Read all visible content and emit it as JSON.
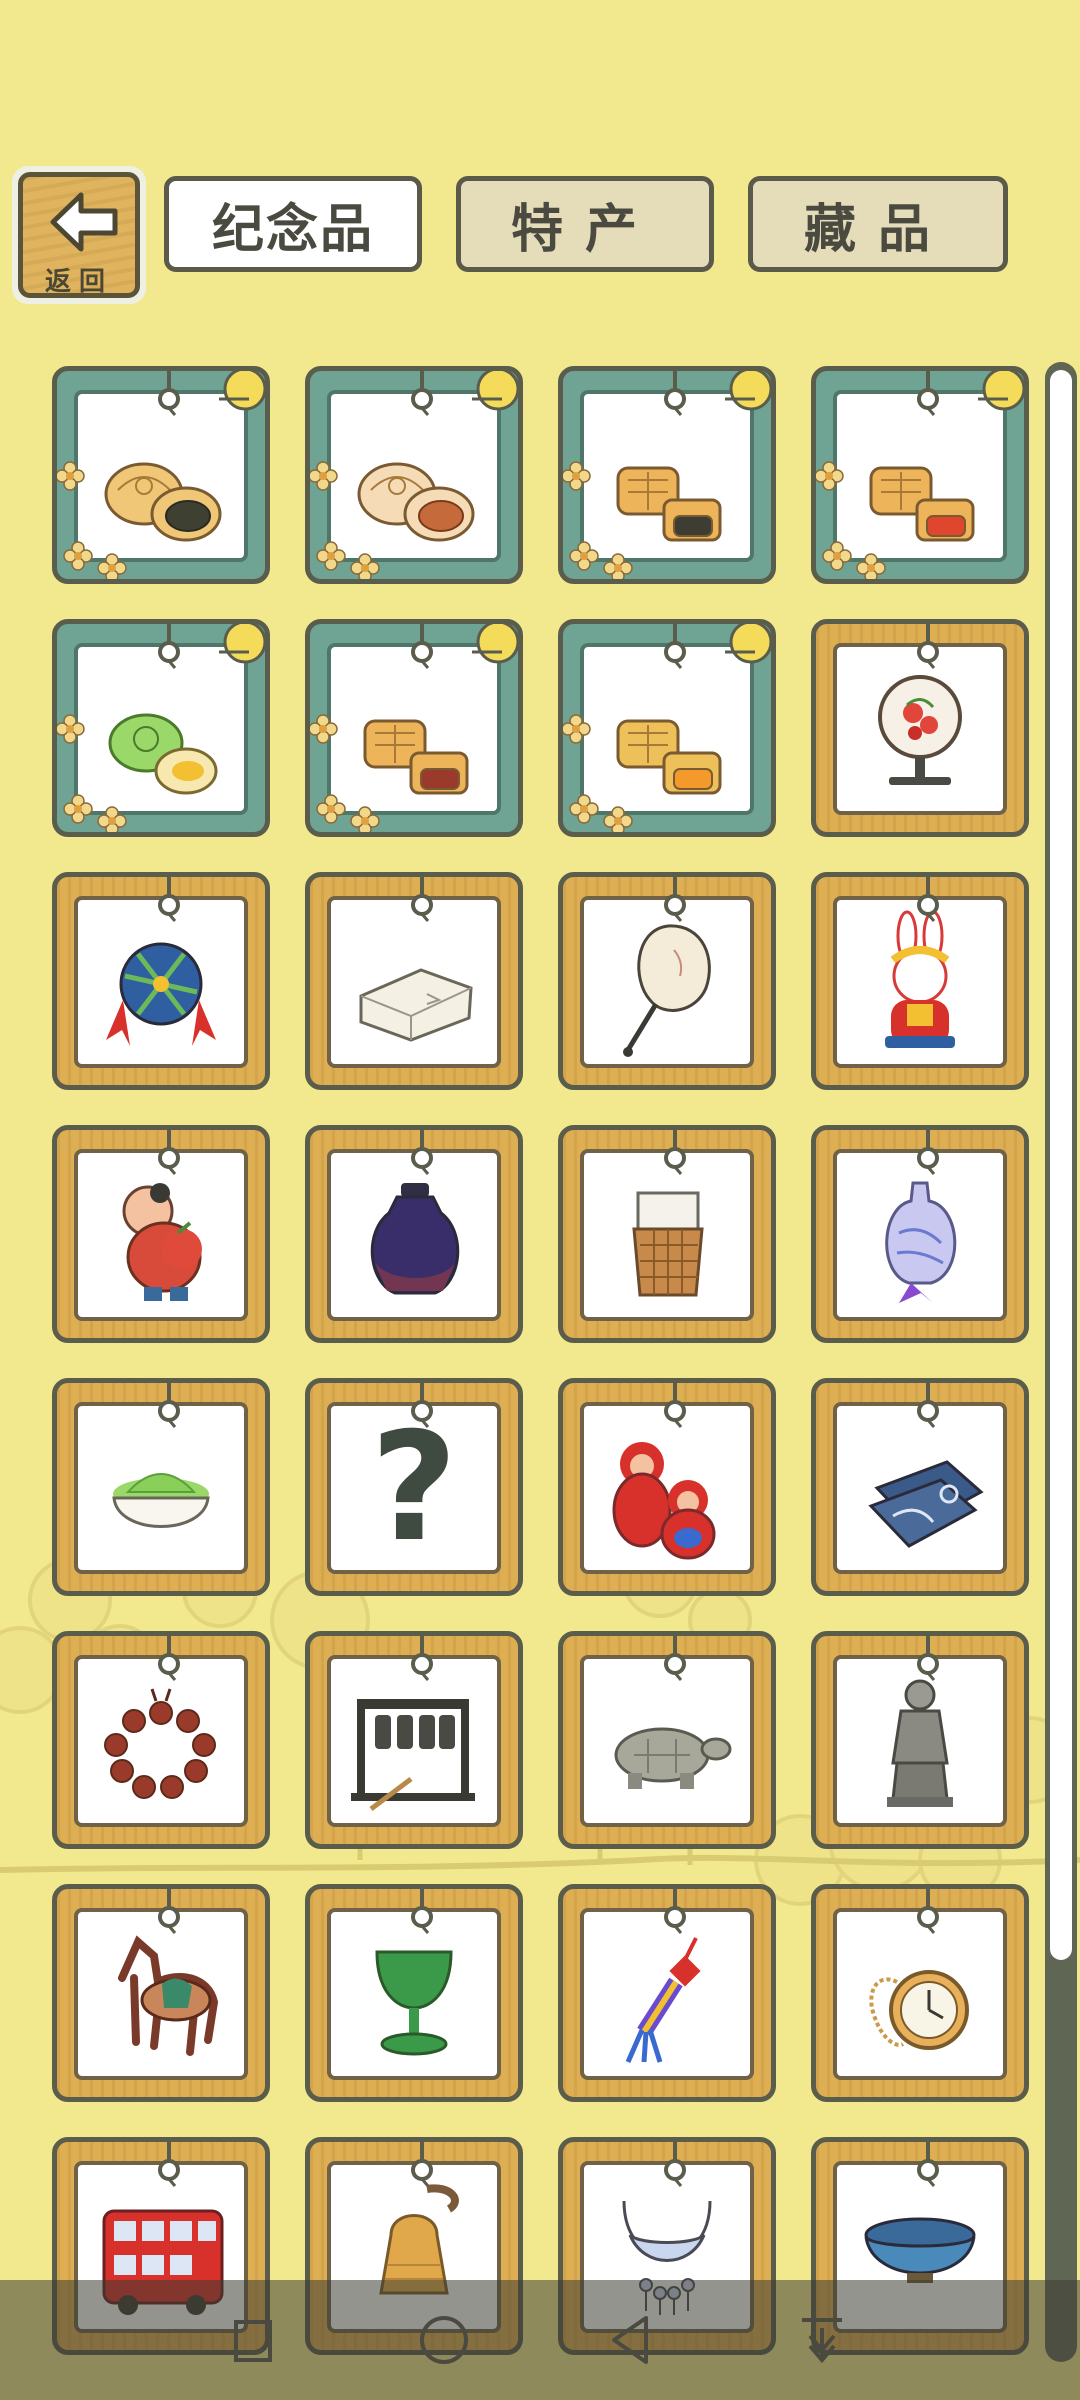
{
  "header": {
    "back_label": "返回",
    "tabs": [
      {
        "label": "纪念品",
        "active": true
      },
      {
        "label": "特产",
        "active": false
      },
      {
        "label": "藏品",
        "active": false
      }
    ]
  },
  "collection": {
    "items": [
      {
        "name": "lotus-seed-mooncake",
        "frame": "teal"
      },
      {
        "name": "red-bean-mooncake",
        "frame": "teal"
      },
      {
        "name": "five-nut-mooncake",
        "frame": "teal"
      },
      {
        "name": "yolk-mooncake",
        "frame": "teal"
      },
      {
        "name": "green-tea-mooncake",
        "frame": "teal"
      },
      {
        "name": "date-paste-mooncake",
        "frame": "teal"
      },
      {
        "name": "orange-mooncake",
        "frame": "teal"
      },
      {
        "name": "embroidery-screen",
        "frame": "gold"
      },
      {
        "name": "embroidered-ball",
        "frame": "gold"
      },
      {
        "name": "silk-pillow",
        "frame": "gold"
      },
      {
        "name": "round-fan",
        "frame": "gold"
      },
      {
        "name": "rabbit-figurine",
        "frame": "gold"
      },
      {
        "name": "clay-doll",
        "frame": "gold"
      },
      {
        "name": "ceramic-jar",
        "frame": "gold"
      },
      {
        "name": "bamboo-cup",
        "frame": "gold"
      },
      {
        "name": "porcelain-pouch",
        "frame": "gold"
      },
      {
        "name": "matcha-bowl",
        "frame": "gold"
      },
      {
        "name": "unknown-item",
        "frame": "gold",
        "label": "?"
      },
      {
        "name": "nesting-dolls",
        "frame": "gold"
      },
      {
        "name": "batik-cloth",
        "frame": "gold"
      },
      {
        "name": "prayer-beads",
        "frame": "gold"
      },
      {
        "name": "bronze-bells",
        "frame": "gold"
      },
      {
        "name": "stone-turtle",
        "frame": "gold"
      },
      {
        "name": "terracotta-warrior",
        "frame": "gold"
      },
      {
        "name": "tang-horse",
        "frame": "gold"
      },
      {
        "name": "green-goblet",
        "frame": "gold"
      },
      {
        "name": "tassel-knot",
        "frame": "gold"
      },
      {
        "name": "pocket-watch",
        "frame": "gold"
      },
      {
        "name": "double-decker-bus",
        "frame": "gold"
      },
      {
        "name": "bronze-bell",
        "frame": "gold"
      },
      {
        "name": "silver-necklace",
        "frame": "gold"
      },
      {
        "name": "tea-bowl",
        "frame": "gold"
      }
    ]
  },
  "colors": {
    "background": "#F2E98E",
    "gold_frame": "#DDAE52",
    "teal_frame": "#6FA393",
    "outline": "#5A5C4C"
  },
  "navbar": {
    "buttons": [
      "recent-apps",
      "home",
      "back",
      "notification-pull"
    ]
  }
}
